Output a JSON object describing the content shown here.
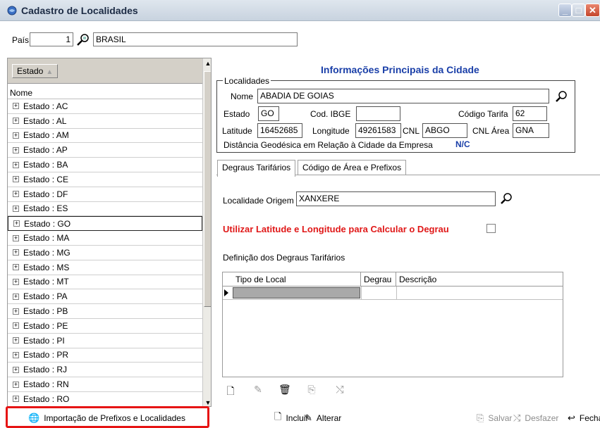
{
  "window": {
    "title": "Cadastro de Localidades"
  },
  "pais": {
    "label": "País",
    "code": "1",
    "name": "BRASIL"
  },
  "estado_panel": {
    "group_button": "Estado",
    "column_header": "Nome",
    "rows": [
      "Estado : AC",
      "Estado : AL",
      "Estado : AM",
      "Estado : AP",
      "Estado : BA",
      "Estado : CE",
      "Estado : DF",
      "Estado : ES",
      "Estado : GO",
      "Estado : MA",
      "Estado : MG",
      "Estado : MS",
      "Estado : MT",
      "Estado : PA",
      "Estado : PB",
      "Estado : PE",
      "Estado : PI",
      "Estado : PR",
      "Estado : RJ",
      "Estado : RN",
      "Estado : RO"
    ],
    "selected_index": 8
  },
  "info": {
    "heading": "Informações Principais da Cidade",
    "legend": "Localidades",
    "nome_label": "Nome",
    "nome_value": "ABADIA DE GOIAS",
    "estado_label": "Estado",
    "estado_value": "GO",
    "ibge_label": "Cod. IBGE",
    "ibge_value": "",
    "tarifa_label": "Código Tarifa",
    "tarifa_value": "62",
    "lat_label": "Latitude",
    "lat_value": "16452685",
    "lon_label": "Longitude",
    "lon_value": "49261583",
    "cnl_label": "CNL",
    "cnl_value": "ABGO",
    "cnl_area_label": "CNL Área",
    "cnl_area_value": "GNA",
    "distancia_label": "Distância Geodésica em Relação à Cidade da Empresa",
    "distancia_value": "N/C"
  },
  "tabs": [
    "Degraus Tarifários",
    "Código de Área e Prefixos"
  ],
  "degraus": {
    "origem_label": "Localidade Origem",
    "origem_value": "XANXERE",
    "latlon_label": "Utilizar Latitude e Longitude para Calcular o Degrau",
    "latlon_checked": false,
    "definicao_label": "Definição dos Degraus Tarifários",
    "grid_headers": [
      "Tipo de Local",
      "Degrau",
      "Descrição"
    ]
  },
  "footer": {
    "import_label": "Importação de  Prefixos e Localidades",
    "incluir": "Incluir",
    "alterar": "Alterar",
    "salvar": "Salvar",
    "desfazer": "Desfazer",
    "fechar": "Fechar"
  },
  "colors": {
    "heading": "#1a3fa8",
    "warning": "#e01818",
    "highlight_frame": "#e61414"
  }
}
